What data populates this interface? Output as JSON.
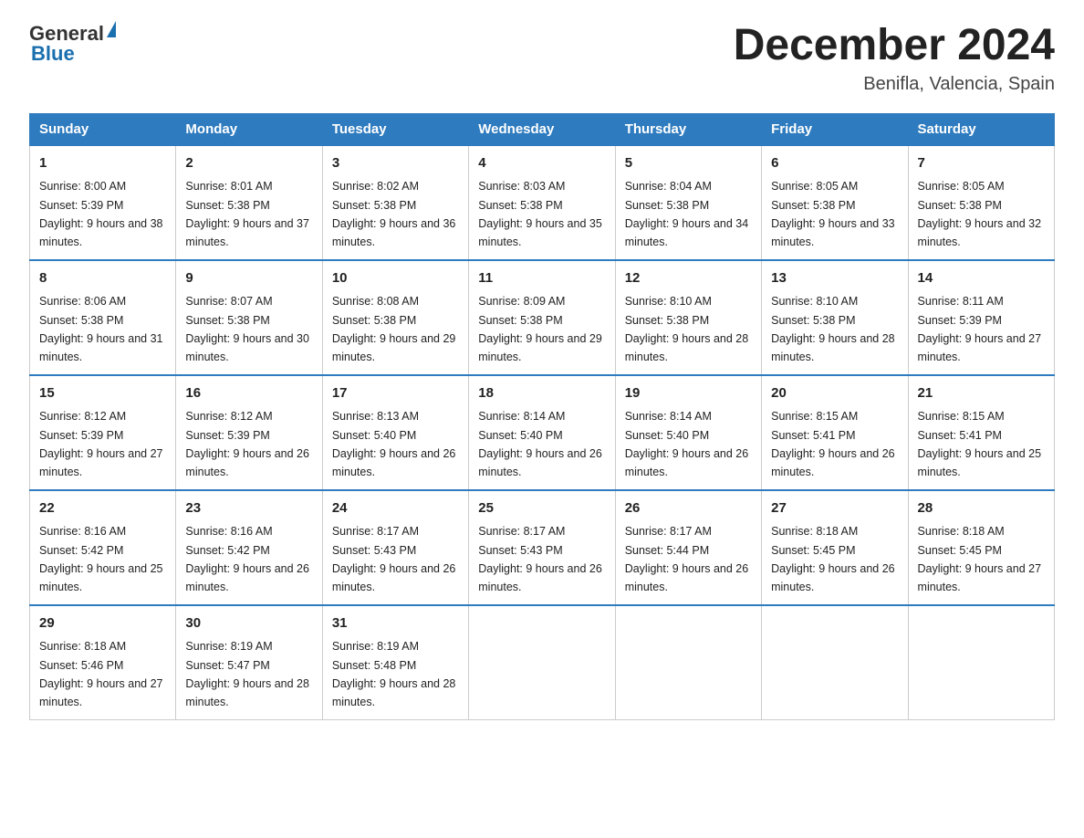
{
  "logo": {
    "general": "General",
    "blue": "Blue"
  },
  "title": "December 2024",
  "subtitle": "Benifla, Valencia, Spain",
  "days_of_week": [
    "Sunday",
    "Monday",
    "Tuesday",
    "Wednesday",
    "Thursday",
    "Friday",
    "Saturday"
  ],
  "weeks": [
    [
      {
        "num": "1",
        "sunrise": "8:00 AM",
        "sunset": "5:39 PM",
        "daylight": "9 hours and 38 minutes."
      },
      {
        "num": "2",
        "sunrise": "8:01 AM",
        "sunset": "5:38 PM",
        "daylight": "9 hours and 37 minutes."
      },
      {
        "num": "3",
        "sunrise": "8:02 AM",
        "sunset": "5:38 PM",
        "daylight": "9 hours and 36 minutes."
      },
      {
        "num": "4",
        "sunrise": "8:03 AM",
        "sunset": "5:38 PM",
        "daylight": "9 hours and 35 minutes."
      },
      {
        "num": "5",
        "sunrise": "8:04 AM",
        "sunset": "5:38 PM",
        "daylight": "9 hours and 34 minutes."
      },
      {
        "num": "6",
        "sunrise": "8:05 AM",
        "sunset": "5:38 PM",
        "daylight": "9 hours and 33 minutes."
      },
      {
        "num": "7",
        "sunrise": "8:05 AM",
        "sunset": "5:38 PM",
        "daylight": "9 hours and 32 minutes."
      }
    ],
    [
      {
        "num": "8",
        "sunrise": "8:06 AM",
        "sunset": "5:38 PM",
        "daylight": "9 hours and 31 minutes."
      },
      {
        "num": "9",
        "sunrise": "8:07 AM",
        "sunset": "5:38 PM",
        "daylight": "9 hours and 30 minutes."
      },
      {
        "num": "10",
        "sunrise": "8:08 AM",
        "sunset": "5:38 PM",
        "daylight": "9 hours and 29 minutes."
      },
      {
        "num": "11",
        "sunrise": "8:09 AM",
        "sunset": "5:38 PM",
        "daylight": "9 hours and 29 minutes."
      },
      {
        "num": "12",
        "sunrise": "8:10 AM",
        "sunset": "5:38 PM",
        "daylight": "9 hours and 28 minutes."
      },
      {
        "num": "13",
        "sunrise": "8:10 AM",
        "sunset": "5:38 PM",
        "daylight": "9 hours and 28 minutes."
      },
      {
        "num": "14",
        "sunrise": "8:11 AM",
        "sunset": "5:39 PM",
        "daylight": "9 hours and 27 minutes."
      }
    ],
    [
      {
        "num": "15",
        "sunrise": "8:12 AM",
        "sunset": "5:39 PM",
        "daylight": "9 hours and 27 minutes."
      },
      {
        "num": "16",
        "sunrise": "8:12 AM",
        "sunset": "5:39 PM",
        "daylight": "9 hours and 26 minutes."
      },
      {
        "num": "17",
        "sunrise": "8:13 AM",
        "sunset": "5:40 PM",
        "daylight": "9 hours and 26 minutes."
      },
      {
        "num": "18",
        "sunrise": "8:14 AM",
        "sunset": "5:40 PM",
        "daylight": "9 hours and 26 minutes."
      },
      {
        "num": "19",
        "sunrise": "8:14 AM",
        "sunset": "5:40 PM",
        "daylight": "9 hours and 26 minutes."
      },
      {
        "num": "20",
        "sunrise": "8:15 AM",
        "sunset": "5:41 PM",
        "daylight": "9 hours and 26 minutes."
      },
      {
        "num": "21",
        "sunrise": "8:15 AM",
        "sunset": "5:41 PM",
        "daylight": "9 hours and 25 minutes."
      }
    ],
    [
      {
        "num": "22",
        "sunrise": "8:16 AM",
        "sunset": "5:42 PM",
        "daylight": "9 hours and 25 minutes."
      },
      {
        "num": "23",
        "sunrise": "8:16 AM",
        "sunset": "5:42 PM",
        "daylight": "9 hours and 26 minutes."
      },
      {
        "num": "24",
        "sunrise": "8:17 AM",
        "sunset": "5:43 PM",
        "daylight": "9 hours and 26 minutes."
      },
      {
        "num": "25",
        "sunrise": "8:17 AM",
        "sunset": "5:43 PM",
        "daylight": "9 hours and 26 minutes."
      },
      {
        "num": "26",
        "sunrise": "8:17 AM",
        "sunset": "5:44 PM",
        "daylight": "9 hours and 26 minutes."
      },
      {
        "num": "27",
        "sunrise": "8:18 AM",
        "sunset": "5:45 PM",
        "daylight": "9 hours and 26 minutes."
      },
      {
        "num": "28",
        "sunrise": "8:18 AM",
        "sunset": "5:45 PM",
        "daylight": "9 hours and 27 minutes."
      }
    ],
    [
      {
        "num": "29",
        "sunrise": "8:18 AM",
        "sunset": "5:46 PM",
        "daylight": "9 hours and 27 minutes."
      },
      {
        "num": "30",
        "sunrise": "8:19 AM",
        "sunset": "5:47 PM",
        "daylight": "9 hours and 28 minutes."
      },
      {
        "num": "31",
        "sunrise": "8:19 AM",
        "sunset": "5:48 PM",
        "daylight": "9 hours and 28 minutes."
      },
      null,
      null,
      null,
      null
    ]
  ]
}
